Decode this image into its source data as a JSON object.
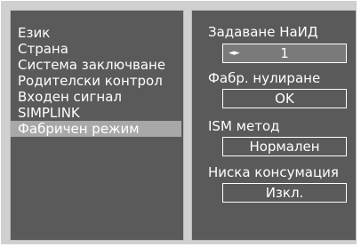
{
  "left_menu": {
    "items": [
      {
        "label": "Език",
        "selected": false
      },
      {
        "label": "Страна",
        "selected": false
      },
      {
        "label": "Система заключване",
        "selected": false
      },
      {
        "label": "Родителски контрол",
        "selected": false
      },
      {
        "label": "Входен сигнал",
        "selected": false
      },
      {
        "label": "SIMPLINK",
        "selected": false
      },
      {
        "label": "Фабричен режим",
        "selected": true
      }
    ]
  },
  "right_panel": {
    "settings": [
      {
        "label": "Задаване НаИД",
        "value": "1",
        "arrows": "◄►"
      },
      {
        "label": "Фабр. нулиране",
        "value": "OK"
      },
      {
        "label": "ISM метод",
        "value": "Нормален"
      },
      {
        "label": "Ниска консумация",
        "value": "Изкл."
      }
    ]
  },
  "colors": {
    "panel_bg": "#5a5a5a",
    "frame_bg": "#d0d0d0",
    "selected_bg": "#a8a8a8",
    "text": "#ffffff"
  }
}
